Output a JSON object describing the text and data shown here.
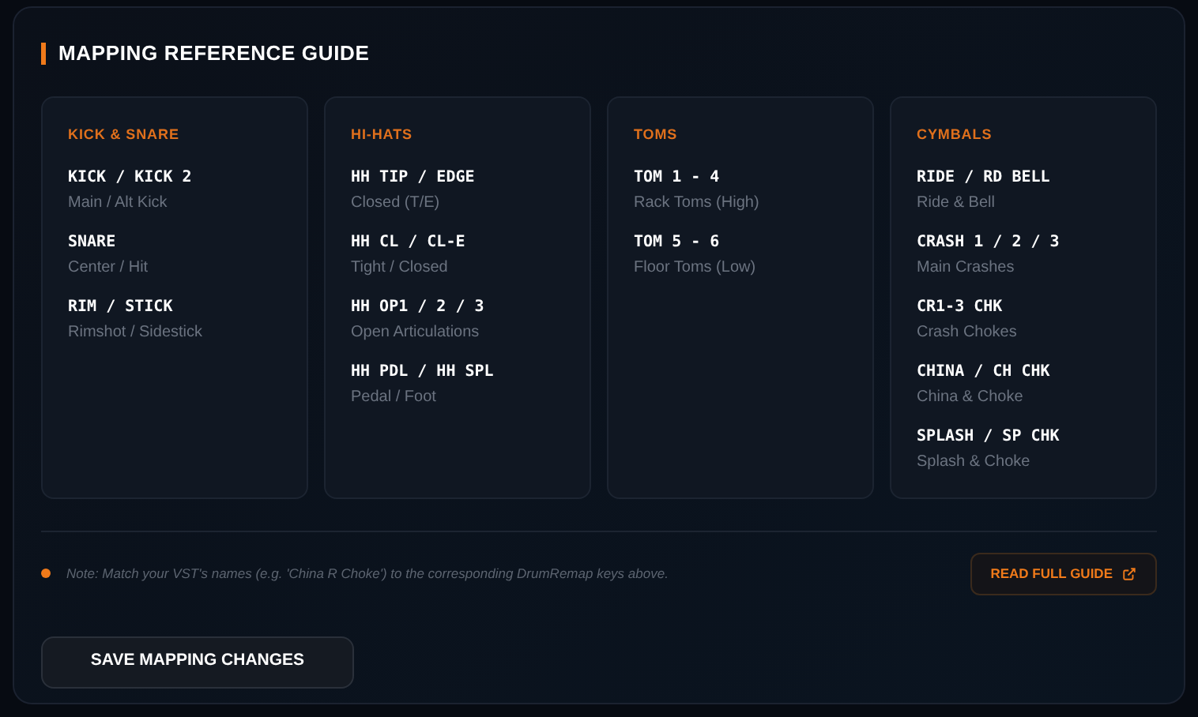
{
  "title": "MAPPING REFERENCE GUIDE",
  "groups": [
    {
      "title": "KICK & SNARE",
      "items": [
        {
          "key": "KICK / KICK 2",
          "desc": "Main / Alt Kick"
        },
        {
          "key": "SNARE",
          "desc": "Center / Hit"
        },
        {
          "key": "RIM / STICK",
          "desc": "Rimshot / Sidestick"
        }
      ]
    },
    {
      "title": "HI-HATS",
      "items": [
        {
          "key": "HH TIP / EDGE",
          "desc": "Closed (T/E)"
        },
        {
          "key": "HH CL / CL-E",
          "desc": "Tight / Closed"
        },
        {
          "key": "HH OP1 / 2 / 3",
          "desc": "Open Articulations"
        },
        {
          "key": "HH PDL / HH SPL",
          "desc": "Pedal / Foot"
        }
      ]
    },
    {
      "title": "TOMS",
      "items": [
        {
          "key": "TOM 1 - 4",
          "desc": "Rack Toms (High)"
        },
        {
          "key": "TOM 5 - 6",
          "desc": "Floor Toms (Low)"
        }
      ]
    },
    {
      "title": "CYMBALS",
      "items": [
        {
          "key": "RIDE / RD BELL",
          "desc": "Ride & Bell"
        },
        {
          "key": "CRASH 1 / 2 / 3",
          "desc": "Main Crashes"
        },
        {
          "key": "CR1-3 CHK",
          "desc": "Crash Chokes"
        },
        {
          "key": "CHINA / CH CHK",
          "desc": "China & Choke"
        },
        {
          "key": "SPLASH / SP CHK",
          "desc": "Splash & Choke"
        }
      ]
    }
  ],
  "note": "Note: Match your VST's names (e.g. 'China R Choke') to the corresponding DrumRemap keys above.",
  "guide_button": "READ FULL GUIDE",
  "save_button": "SAVE MAPPING CHANGES"
}
